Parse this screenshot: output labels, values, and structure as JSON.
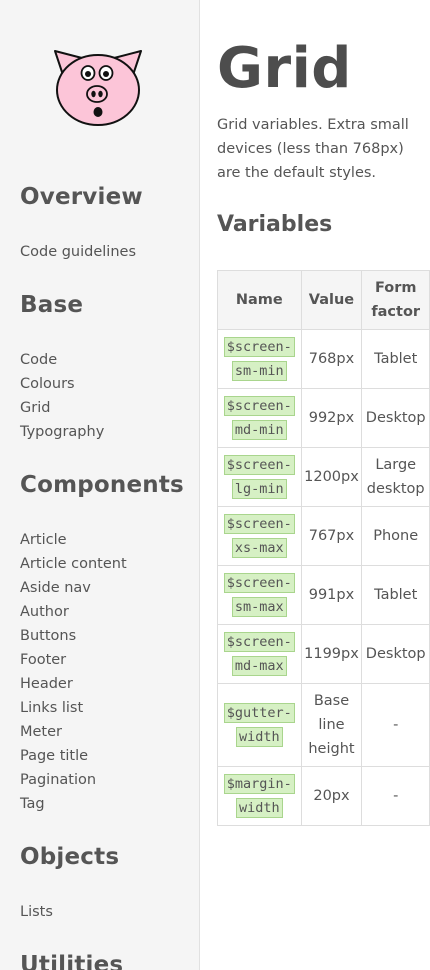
{
  "sidebar": {
    "logo_icon": "pig-face-icon",
    "sections": [
      {
        "heading": "Overview",
        "items": [
          "Code guidelines"
        ]
      },
      {
        "heading": "Base",
        "items": [
          "Code",
          "Colours",
          "Grid",
          "Typography"
        ]
      },
      {
        "heading": "Components",
        "items": [
          "Article",
          "Article content",
          "Aside nav",
          "Author",
          "Buttons",
          "Footer",
          "Header",
          "Links list",
          "Meter",
          "Page title",
          "Pagination",
          "Tag"
        ]
      },
      {
        "heading": "Objects",
        "items": [
          "Lists"
        ]
      },
      {
        "heading": "Utilities",
        "items": []
      }
    ]
  },
  "main": {
    "title": "Grid",
    "intro": "Grid variables. Extra small devices (less than 768px) are the default styles.",
    "section_title": "Variables",
    "table": {
      "headers": [
        "Name",
        "Value",
        "Form factor"
      ],
      "rows": [
        {
          "name": "$screen-sm-min",
          "value": "768px",
          "form_factor": "Tablet"
        },
        {
          "name": "$screen-md-min",
          "value": "992px",
          "form_factor": "Desktop"
        },
        {
          "name": "$screen-lg-min",
          "value": "1200px",
          "form_factor": "Large desktop"
        },
        {
          "name": "$screen-xs-max",
          "value": "767px",
          "form_factor": "Phone"
        },
        {
          "name": "$screen-sm-max",
          "value": "991px",
          "form_factor": "Tablet"
        },
        {
          "name": "$screen-md-max",
          "value": "1199px",
          "form_factor": "Desktop"
        },
        {
          "name": "$gutter-width",
          "value": "Base line height",
          "form_factor": "-"
        },
        {
          "name": "$margin-width",
          "value": "20px",
          "form_factor": "-"
        }
      ]
    }
  },
  "colors": {
    "sidebar_bg": "#f5f5f5",
    "code_bg": "#d6f0c4",
    "code_border": "#a9d58d",
    "pig_pink": "#fcc5d8",
    "text": "#555555"
  }
}
